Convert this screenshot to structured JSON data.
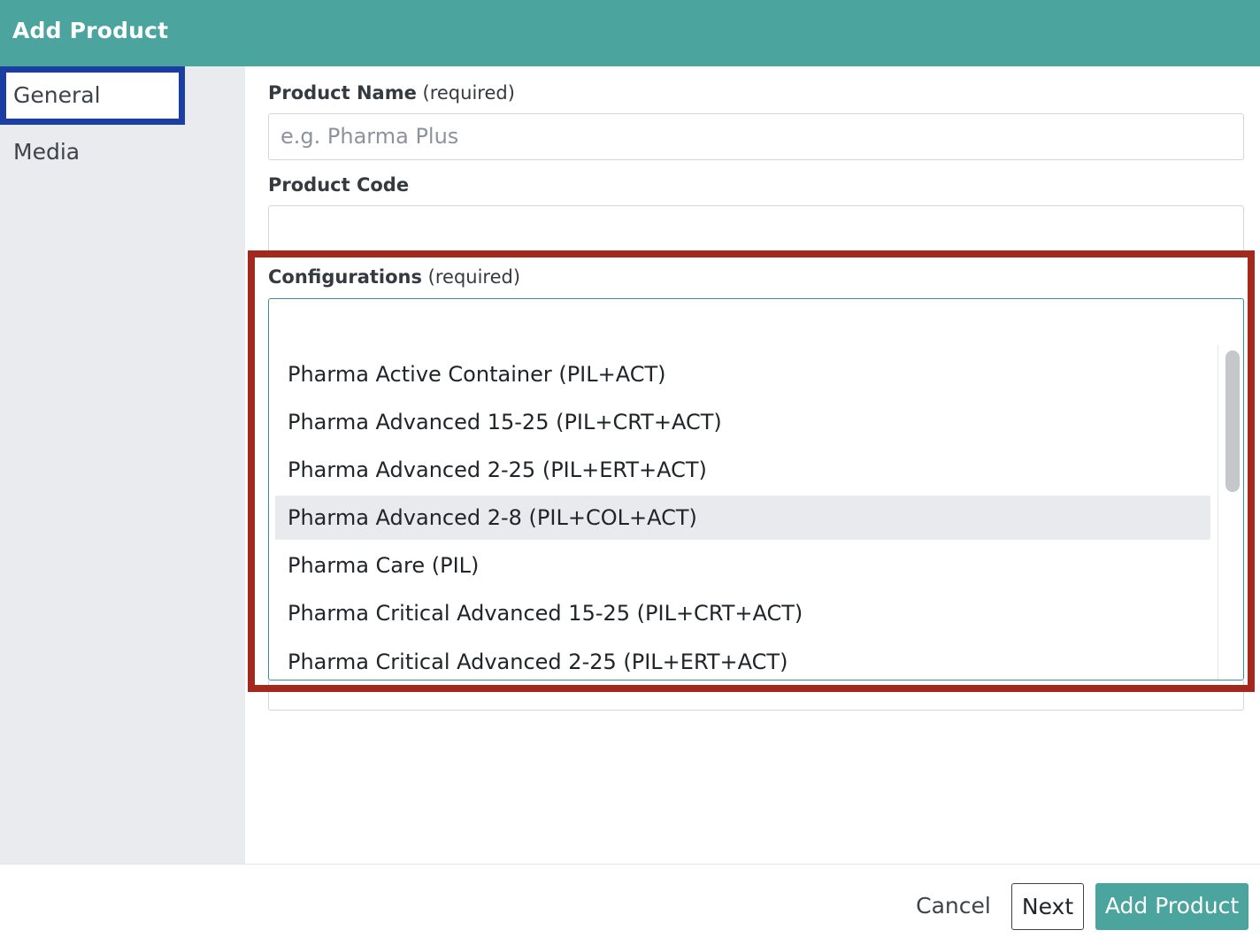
{
  "header": {
    "title": "Add Product"
  },
  "sidebar": {
    "items": [
      {
        "label": "General",
        "active": true
      },
      {
        "label": "Media",
        "active": false
      }
    ]
  },
  "form": {
    "product_name": {
      "label": "Product Name",
      "required": "(required)",
      "value": "",
      "placeholder": "e.g. Pharma Plus"
    },
    "product_code": {
      "label": "Product Code",
      "value": ""
    },
    "configurations": {
      "label": "Configurations",
      "required": "(required)",
      "value": "",
      "options": [
        "Pharma Active Container (PIL+ACT)",
        "Pharma Advanced 15-25 (PIL+CRT+ACT)",
        "Pharma Advanced 2-25 (PIL+ERT+ACT)",
        "Pharma Advanced 2-8 (PIL+COL+ACT)",
        "Pharma Care (PIL)",
        "Pharma Critical Advanced 15-25 (PIL+CRT+ACT)",
        "Pharma Critical Advanced 2-25 (PIL+ERT+ACT)"
      ],
      "highlighted_option": "Pharma Advanced 2-8 (PIL+COL+ACT)"
    }
  },
  "footer": {
    "cancel_label": "Cancel",
    "next_label": "Next",
    "add_label": "Add Product"
  },
  "colors": {
    "brand": "#4ba59e",
    "active_tab_outline": "#1a3ea1",
    "config_highlight_outline": "#a3281d"
  }
}
